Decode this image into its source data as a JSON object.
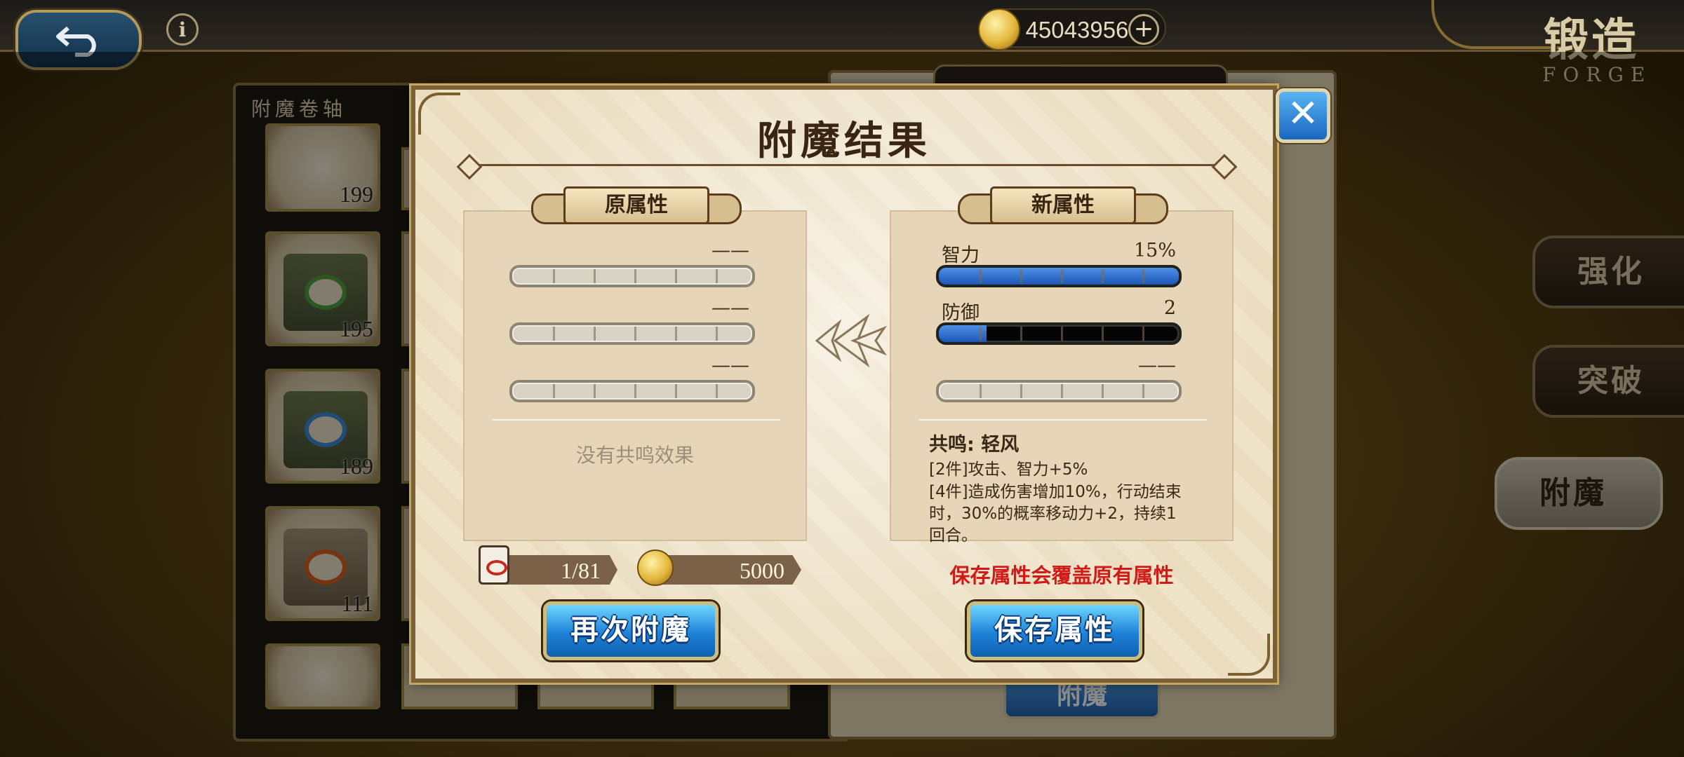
{
  "topbar": {
    "gold_amount": "45043956",
    "screen_title": "锻造",
    "screen_subtitle": "FORGE"
  },
  "background": {
    "scroll_tab_label": "附魔卷轴",
    "scroll_items": [
      {
        "count": "199",
        "emblem_color": "#4fa03c"
      },
      {
        "count": "195",
        "emblem_color": "#4fa03c"
      },
      {
        "count": "189",
        "emblem_color": "#3e8ad6"
      },
      {
        "count": "111",
        "emblem_color": "#d8621e"
      }
    ],
    "side_menu": [
      "强化",
      "突破",
      "附魔"
    ],
    "enchant_button_label": "附魔"
  },
  "dialog": {
    "title": "附魔结果",
    "old_attributes": {
      "ribbon_label": "原属性",
      "stats": [
        {
          "name": "",
          "value": "——",
          "fill": 0
        },
        {
          "name": "",
          "value": "——",
          "fill": 0
        },
        {
          "name": "",
          "value": "——",
          "fill": 0
        }
      ],
      "resonance_text": "没有共鸣效果"
    },
    "new_attributes": {
      "ribbon_label": "新属性",
      "stats": [
        {
          "name": "智力",
          "value": "15%",
          "fill": 1.0
        },
        {
          "name": "防御",
          "value": "2",
          "fill": 0.2
        },
        {
          "name": "",
          "value": "——",
          "fill": 0
        }
      ],
      "resonance_title": "共鸣: 轻风",
      "resonance_lines": [
        "[2件]攻击、智力+5%",
        "[4件]造成伤害增加10%，行动结束",
        "时，30%的概率移动力+2，持续1",
        "回合。"
      ]
    },
    "scroll_cost": "1/81",
    "gold_cost": "5000",
    "warning": "保存属性会覆盖原有属性",
    "reenchant_button": "再次附魔",
    "save_button": "保存属性",
    "accent_blue": "#1c56b8",
    "warning_color": "#d01c18"
  }
}
